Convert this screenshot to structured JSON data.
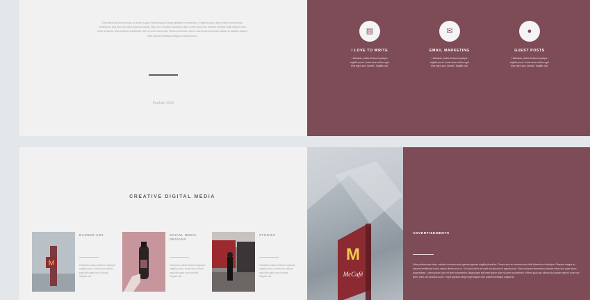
{
  "intro": {
    "text": "Sunt lacinia sit amet cursus sit amet. Augue mauris augue neque gravida in fermentum. Euismod quis viverra nibh cras pulvinar. Vestibulum sed arcu non odio euismod lacinia. Nisl nunc mi ipsum faucibus vitae. Lorem sed risus ultricies tristique nulla aliquet enim tortor at auctor. Duis tristique sollicitudin nibh sit amet commodo. Risus commodo viverra maecenas accumsan lacus vel facilisis. Aliquet nibh praesent tristique magna sit amet purus.",
    "portfolio_label": "Portfolio 2020"
  },
  "features": [
    {
      "icon": "document-icon",
      "glyph": "▤",
      "title": "I LOVE TO WRITE",
      "text": "Habitasse platea dictumst quisque sagittis purus. Amet risus nullam eget felis eget nunc lobortis. Sagittis nisl."
    },
    {
      "icon": "email-icon",
      "glyph": "✉",
      "title": "EMAIL MARKETING",
      "text": "Habitasse platea dictumst quisque sagittis purus. Amet risus nullam eget felis eget nunc lobortis. Sagittis nisl."
    },
    {
      "icon": "user-icon",
      "glyph": "●",
      "title": "GUEST POSTS",
      "text": "Habitasse platea dictumst quisque sagittis purus. Amet risus nullam eget felis eget nunc lobortis. Sagittis nisl."
    }
  ],
  "media": {
    "title": "CREATIVE DIGITAL MEDIA",
    "cards": [
      {
        "title": "BANNER ADS",
        "text": "Habitasse platea dictumst quisque sagittis purus. Amet risus nullam eget felis eget nunc lobortis. Sagittis nisl."
      },
      {
        "title": "SOCIAL MEDIA DESIGNS",
        "text": "Habitasse platea dictumst quisque sagittis purus. Amet risus nullam eget felis eget nunc lobortis. Sagittis nisl."
      },
      {
        "title": "STORIES",
        "text": "Habitasse platea dictumst quisque sagittis purus. Amet risus nullam eget felis eget nunc lobortis. Sagittis nisl."
      }
    ]
  },
  "ads": {
    "title": "ADVERTISEMENTS",
    "text": "Vitae pellentesque diam volutpat commodo sed egestas egestas fringilla phasellus. Ornare arcu dui vivamus arcu felis bibendum ut tristique. Pharetra magna ac placerat vestibulum lectus mauris ultrices eros in. Ut ornare lectus sit amet est placerat in egestas erat. Diam vel quam elementum pulvinar etiam non quam lacus suspendisse. Lorem ipsum dolor sit amet consectetur. Magna eget est lorem ipsum dolor sit amet consectetur. Viverra justo nec ultrices dui sapien eget mi proin sed libero enim sed faucibus turpis. Turpis egestas integer eget aliquet nibh praesent tristique magna sit."
  },
  "colors": {
    "accent": "#7e4c57",
    "panel_light": "#f1f1f1",
    "background": "#e3e7ea"
  },
  "logo": {
    "arch_letter": "M",
    "sign_text": "McCafé"
  }
}
